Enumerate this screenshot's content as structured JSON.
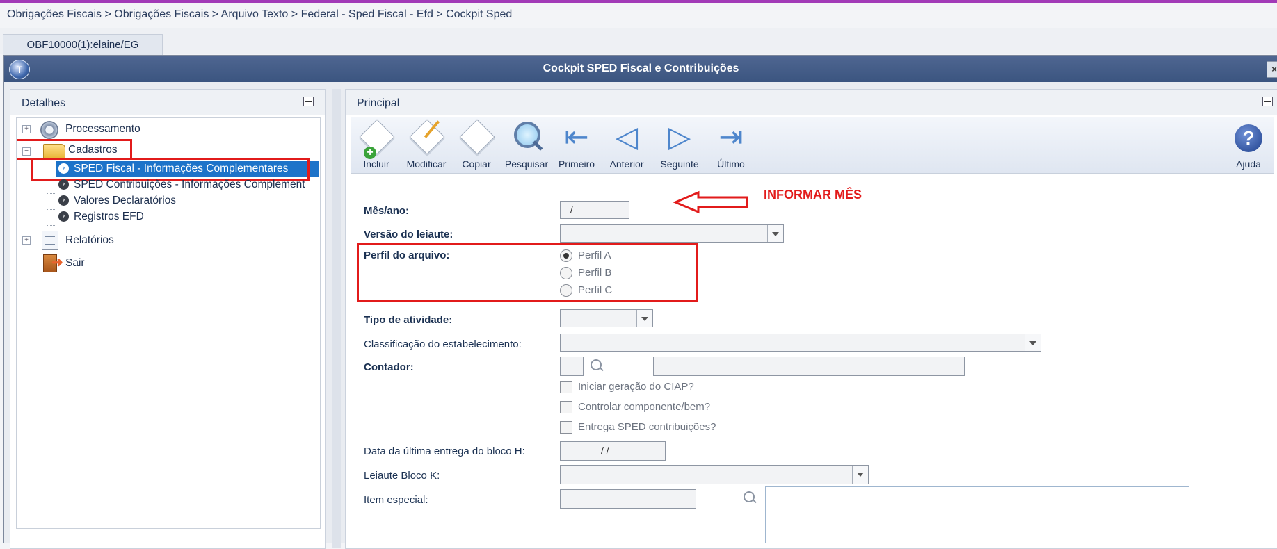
{
  "breadcrumb": "Obrigações Fiscais > Obrigações Fiscais > Arquivo Texto > Federal - Sped Fiscal - Efd > Cockpit Sped",
  "tab_label": "OBF10000(1):elaine/EG",
  "window_title": "Cockpit SPED Fiscal e Contribuições",
  "left_panel": {
    "title": "Detalhes",
    "tree": {
      "processamento": "Processamento",
      "cadastros": "Cadastros",
      "sped_fiscal": "SPED Fiscal - Informações Complementares",
      "sped_contrib": "SPED Contribuições - Informações Complement",
      "valores": "Valores Declaratórios",
      "registros": "Registros EFD",
      "relatorios": "Relatórios",
      "sair": "Sair"
    }
  },
  "right_panel": {
    "title": "Principal",
    "toolbar": {
      "incluir": "Incluir",
      "modificar": "Modificar",
      "copiar": "Copiar",
      "pesquisar": "Pesquisar",
      "primeiro": "Primeiro",
      "anterior": "Anterior",
      "seguinte": "Seguinte",
      "ultimo": "Último",
      "ajuda": "Ajuda"
    },
    "form": {
      "mes_ano_label": "Mês/ano:",
      "mes_ano_value": "/",
      "versao_label": "Versão do leiaute:",
      "perfil_label": "Perfil do arquivo:",
      "perfil_a": "Perfil A",
      "perfil_b": "Perfil B",
      "perfil_c": "Perfil C",
      "tipo_label": "Tipo de atividade:",
      "classificacao_label": "Classificação do estabelecimento:",
      "contador_label": "Contador:",
      "ciap_label": "Iniciar geração do CIAP?",
      "componente_label": "Controlar componente/bem?",
      "entrega_label": "Entrega SPED contribuições?",
      "data_bloco_label": "Data da última entrega do bloco H:",
      "data_bloco_value": "/ /",
      "bloco_k_label": "Leiaute Bloco K:",
      "item_label": "Item especial:"
    }
  },
  "annotation": "INFORMAR MÊS",
  "colors": {
    "accent": "#1d73c9",
    "title_bar": "#3b5580",
    "annotation_red": "#e21b1b"
  }
}
